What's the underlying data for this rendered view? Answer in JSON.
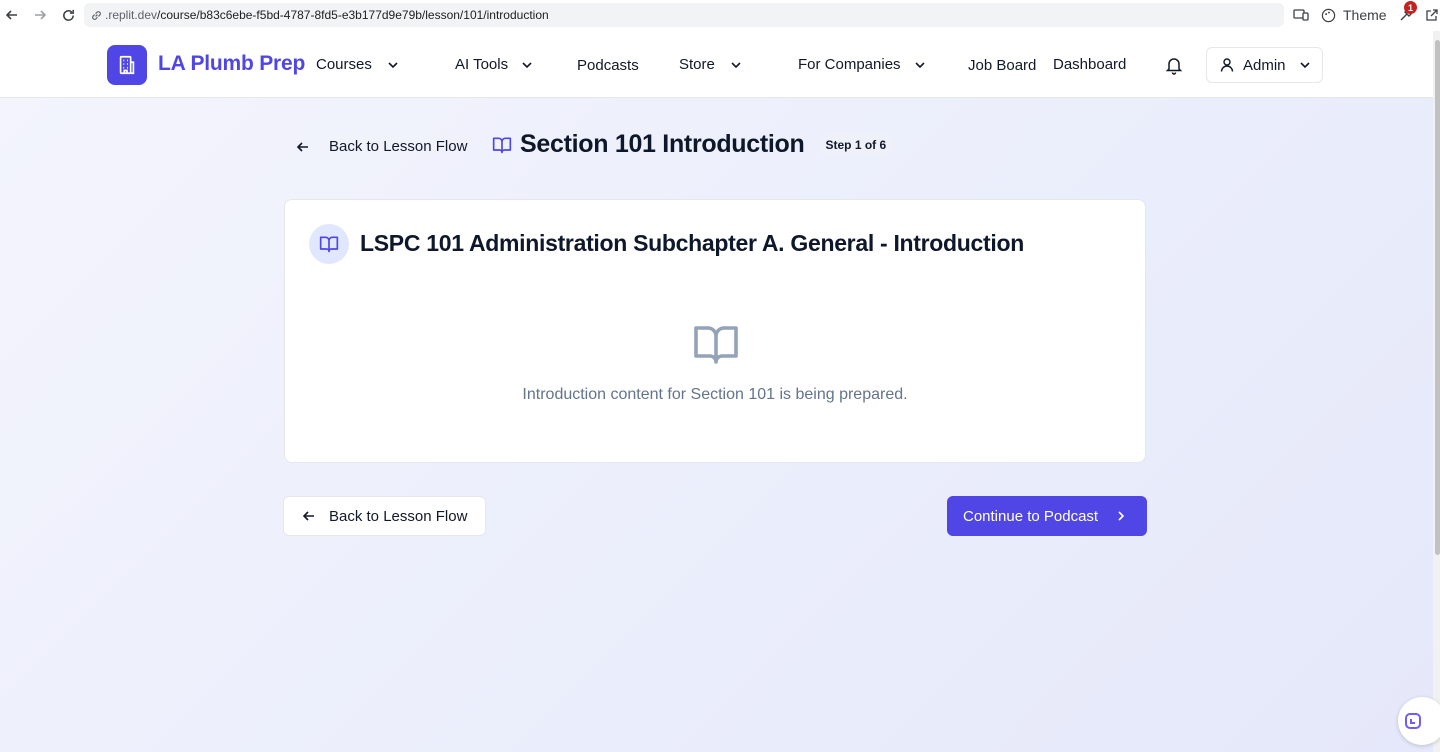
{
  "browser": {
    "url_host": ".replit.dev",
    "url_path": "/course/b83c6ebe-f5bd-4787-8fd5-e3b177d9e79b/lesson/101/introduction",
    "theme_label": "Theme",
    "extension_badge": "1"
  },
  "header": {
    "brand": "LA Plumb Prep",
    "nav": {
      "courses": "Courses",
      "ai_tools": "AI Tools",
      "podcasts": "Podcasts",
      "store": "Store",
      "for_companies": "For Companies",
      "job_board": "Job Board",
      "dashboard": "Dashboard"
    },
    "user_label": "Admin"
  },
  "page": {
    "back_top_label": "Back to Lesson Flow",
    "title": "Section 101 Introduction",
    "step_label": "Step 1 of 6"
  },
  "card": {
    "title": "LSPC 101 Administration Subchapter A. General - Introduction",
    "empty_message": "Introduction content for Section 101 is being prepared."
  },
  "footer_actions": {
    "back_label": "Back to Lesson Flow",
    "continue_label": "Continue to Podcast"
  },
  "colors": {
    "accent": "#4f46e5",
    "muted_text": "#64748b"
  }
}
